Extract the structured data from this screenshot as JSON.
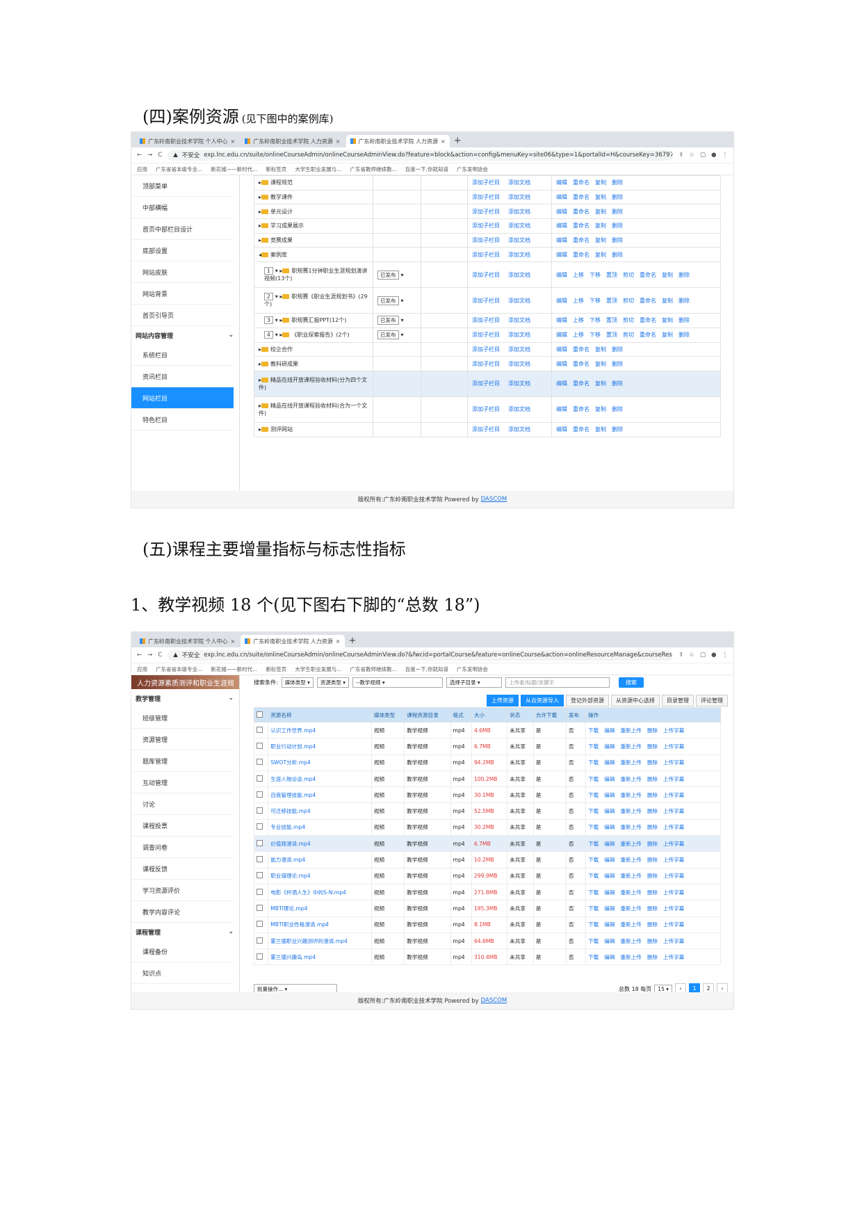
{
  "section4": {
    "title": "(四)案例资源",
    "note": "(见下图中的案例库)"
  },
  "section5": {
    "title": "(五)课程主要增量指标与标志性指标"
  },
  "item1": {
    "title": "1、教学视频 18 个(见下图右下脚的“总数 18”)"
  },
  "shot1": {
    "tabs": [
      {
        "label": "广东岭南职业技术学院 个人中心"
      },
      {
        "label": "广东岭南职业技术学院 人力资源"
      },
      {
        "label": "广东岭南职业技术学院 人力资源"
      }
    ],
    "url_prefix": "不安全",
    "url": "exp.lnc.edu.cn/suite/onlineCourseAdmin/onlineCourseAdminView.do?feature=block&action=config&menuKey=site06&type=1&portalId=H&courseKey=36797505...",
    "bookmarks": [
      "应用",
      "广东省省本级专业...",
      "新花城——新时代...",
      "新标签页",
      "大学生职业发展与...",
      "广东省教师继续教...",
      "百度一下,你就知道",
      "广东发明协会"
    ],
    "sidebar": [
      {
        "label": "顶部菜单",
        "type": "item"
      },
      {
        "label": "中部横幅",
        "type": "item"
      },
      {
        "label": "首页中部栏目设计",
        "type": "item"
      },
      {
        "label": "底部设置",
        "type": "item"
      },
      {
        "label": "网站皮肤",
        "type": "item"
      },
      {
        "label": "网站背景",
        "type": "item"
      },
      {
        "label": "首页引导页",
        "type": "item"
      },
      {
        "label": "网站内容管理",
        "type": "group"
      },
      {
        "label": "系统栏目",
        "type": "item"
      },
      {
        "label": "资讯栏目",
        "type": "item"
      },
      {
        "label": "网站栏目",
        "type": "active"
      },
      {
        "label": "特色栏目",
        "type": "item"
      }
    ],
    "ops_short": [
      "编辑",
      "重命名",
      "复制",
      "删除"
    ],
    "ops_long": [
      "编辑",
      "上移",
      "下移",
      "置顶",
      "剪切",
      "重命名",
      "复制",
      "删除"
    ],
    "add_links": [
      "添加子栏目",
      "添加文档"
    ],
    "rows": [
      {
        "name": "课程规范",
        "level": 0,
        "ops": "short"
      },
      {
        "name": "教学课件",
        "level": 0,
        "ops": "short"
      },
      {
        "name": "单元设计",
        "level": 0,
        "ops": "short"
      },
      {
        "name": "学习成果展示",
        "level": 0,
        "ops": "short"
      },
      {
        "name": "竞赛成果",
        "level": 0,
        "ops": "short"
      },
      {
        "name": "案例库",
        "level": 0,
        "ops": "short",
        "open": true
      },
      {
        "name": "职规赛1分钟职业生涯规划演讲视频(13个)",
        "level": 1,
        "order": "1",
        "status": "已发布",
        "ops": "long",
        "tall": true
      },
      {
        "name": "职规赛《职业生涯规划书》(29个)",
        "level": 1,
        "order": "2",
        "status": "已发布",
        "ops": "long",
        "tall": true
      },
      {
        "name": "职规赛汇报PPT(12个)",
        "level": 1,
        "order": "3",
        "status": "已发布",
        "ops": "long"
      },
      {
        "name": "《职业探索报告》(2个)",
        "level": 1,
        "order": "4",
        "status": "已发布",
        "ops": "long"
      },
      {
        "name": "校企合作",
        "level": 0,
        "ops": "short"
      },
      {
        "name": "教科研成果",
        "level": 0,
        "ops": "short"
      },
      {
        "name": "精品在线开放课程验收材料(分为四个文件)",
        "level": 0,
        "ops": "short",
        "tall": true,
        "hl": true
      },
      {
        "name": "精品在线开放课程验收材料(合为一个文件)",
        "level": 0,
        "ops": "short",
        "tall": true
      },
      {
        "name": "测评网站",
        "level": 0,
        "ops": "short"
      }
    ],
    "footer": "版权所有:广东岭南职业技术学院 Powered by",
    "footer_link": "DASCOM"
  },
  "shot2": {
    "tabs": [
      {
        "label": "广东岭南职业技术学院 个人中心"
      },
      {
        "label": "广东岭南职业技术学院 人力资源"
      }
    ],
    "url_prefix": "不安全",
    "url": "exp.lnc.edu.cn/suite/onlineCourseAdmin/onlineCourseAdminView.do?&fwcid=portalCourse&feature=onlineCourse&action=onlineResourceManage&courseResTyp...",
    "bookmarks": [
      "应用",
      "广东省省本级专业...",
      "新花城——新时代...",
      "新标签页",
      "大学生职业发展与...",
      "广东省教师继续教...",
      "百度一下,你就知道",
      "广东发明协会"
    ],
    "banner": "人力资源素质测评和职业生涯规",
    "sidebar": [
      {
        "label": "教学管理",
        "type": "group"
      },
      {
        "label": "班级管理",
        "type": "item"
      },
      {
        "label": "资源管理",
        "type": "item"
      },
      {
        "label": "题库管理",
        "type": "item"
      },
      {
        "label": "互动管理",
        "type": "item"
      },
      {
        "label": "讨论",
        "type": "item"
      },
      {
        "label": "课程投票",
        "type": "item"
      },
      {
        "label": "调查问卷",
        "type": "item"
      },
      {
        "label": "课程反馈",
        "type": "item"
      },
      {
        "label": "学习资源评价",
        "type": "item"
      },
      {
        "label": "教学内容评论",
        "type": "item"
      },
      {
        "label": "课程管理",
        "type": "group"
      },
      {
        "label": "课程备份",
        "type": "item"
      },
      {
        "label": "知识点",
        "type": "item"
      }
    ],
    "search": {
      "label": "搜索条件:",
      "media_type": "媒体类型",
      "res_type": "资源类型",
      "catalog": "--教学视频",
      "sub_catalog": "选择子目录",
      "placeholder": "上传者/标题/关键字",
      "button": "搜索"
    },
    "toolbar": [
      "上传资源",
      "从云资源导入",
      "登记外部资源",
      "从资源中心选择",
      "目录管理",
      "评论管理"
    ],
    "headers": [
      "资源名称",
      "媒体类型",
      "课程资源目录",
      "格式",
      "大小",
      "状态",
      "允许下载",
      "发布",
      "操作"
    ],
    "ops": [
      "下载",
      "编辑",
      "重新上传",
      "删除",
      "上传字幕"
    ],
    "rows": [
      {
        "name": "认识工作世界.mp4",
        "media": "视频",
        "catalog": "教学视频",
        "format": "mp4",
        "size": "4.6MB",
        "status": "未共享",
        "download": "是",
        "publish": "否"
      },
      {
        "name": "职业行动计划.mp4",
        "media": "视频",
        "catalog": "教学视频",
        "format": "mp4",
        "size": "6.7MB",
        "status": "未共享",
        "download": "是",
        "publish": "否"
      },
      {
        "name": "SWOT分析.mp4",
        "media": "视频",
        "catalog": "教学视频",
        "format": "mp4",
        "size": "94.2MB",
        "status": "未共享",
        "download": "是",
        "publish": "否"
      },
      {
        "name": "生涯人物访谈.mp4",
        "media": "视频",
        "catalog": "教学视频",
        "format": "mp4",
        "size": "100.2MB",
        "status": "未共享",
        "download": "是",
        "publish": "否"
      },
      {
        "name": "自我管理技能.mp4",
        "media": "视频",
        "catalog": "教学视频",
        "format": "mp4",
        "size": "30.1MB",
        "status": "未共享",
        "download": "是",
        "publish": "否"
      },
      {
        "name": "可迁移技能.mp4",
        "media": "视频",
        "catalog": "教学视频",
        "format": "mp4",
        "size": "52.5MB",
        "status": "未共享",
        "download": "是",
        "publish": "否"
      },
      {
        "name": "专业技能.mp4",
        "media": "视频",
        "catalog": "教学视频",
        "format": "mp4",
        "size": "30.2MB",
        "status": "未共享",
        "download": "是",
        "publish": "否"
      },
      {
        "name": "价值观澄清.mp4",
        "media": "视频",
        "catalog": "教学视频",
        "format": "mp4",
        "size": "6.7MB",
        "status": "未共享",
        "download": "是",
        "publish": "否",
        "hl": true
      },
      {
        "name": "能力澄清.mp4",
        "media": "视频",
        "catalog": "教学视频",
        "format": "mp4",
        "size": "10.2MB",
        "status": "未共享",
        "download": "是",
        "publish": "否"
      },
      {
        "name": "职业锚理论.mp4",
        "media": "视频",
        "catalog": "教学视频",
        "format": "mp4",
        "size": "299.9MB",
        "status": "未共享",
        "download": "是",
        "publish": "否"
      },
      {
        "name": "电影《杯酒人生》中的S-N.mp4",
        "media": "视频",
        "catalog": "教学视频",
        "format": "mp4",
        "size": "271.8MB",
        "status": "未共享",
        "download": "是",
        "publish": "否"
      },
      {
        "name": "MBTI理论.mp4",
        "media": "视频",
        "catalog": "教学视频",
        "format": "mp4",
        "size": "195.3MB",
        "status": "未共享",
        "download": "是",
        "publish": "否"
      },
      {
        "name": "MBTI职业性格澄清.mp4",
        "media": "视频",
        "catalog": "教学视频",
        "format": "mp4",
        "size": "8.1MB",
        "status": "未共享",
        "download": "是",
        "publish": "否"
      },
      {
        "name": "霍兰德职业兴趣测评的澄清.mp4",
        "media": "视频",
        "catalog": "教学视频",
        "format": "mp4",
        "size": "64.6MB",
        "status": "未共享",
        "download": "是",
        "publish": "否"
      },
      {
        "name": "霍兰德兴趣岛.mp4",
        "media": "视频",
        "catalog": "教学视频",
        "format": "mp4",
        "size": "310.4MB",
        "status": "未共享",
        "download": "是",
        "publish": "否"
      }
    ],
    "batch": "批量操作...",
    "pager": {
      "total_label": "总数 18 每页",
      "per_page": "15",
      "pages": [
        "1",
        "2"
      ],
      "current": "1"
    },
    "footer": "版权所有:广东岭南职业技术学院 Powered by",
    "footer_link": "DASCOM"
  }
}
